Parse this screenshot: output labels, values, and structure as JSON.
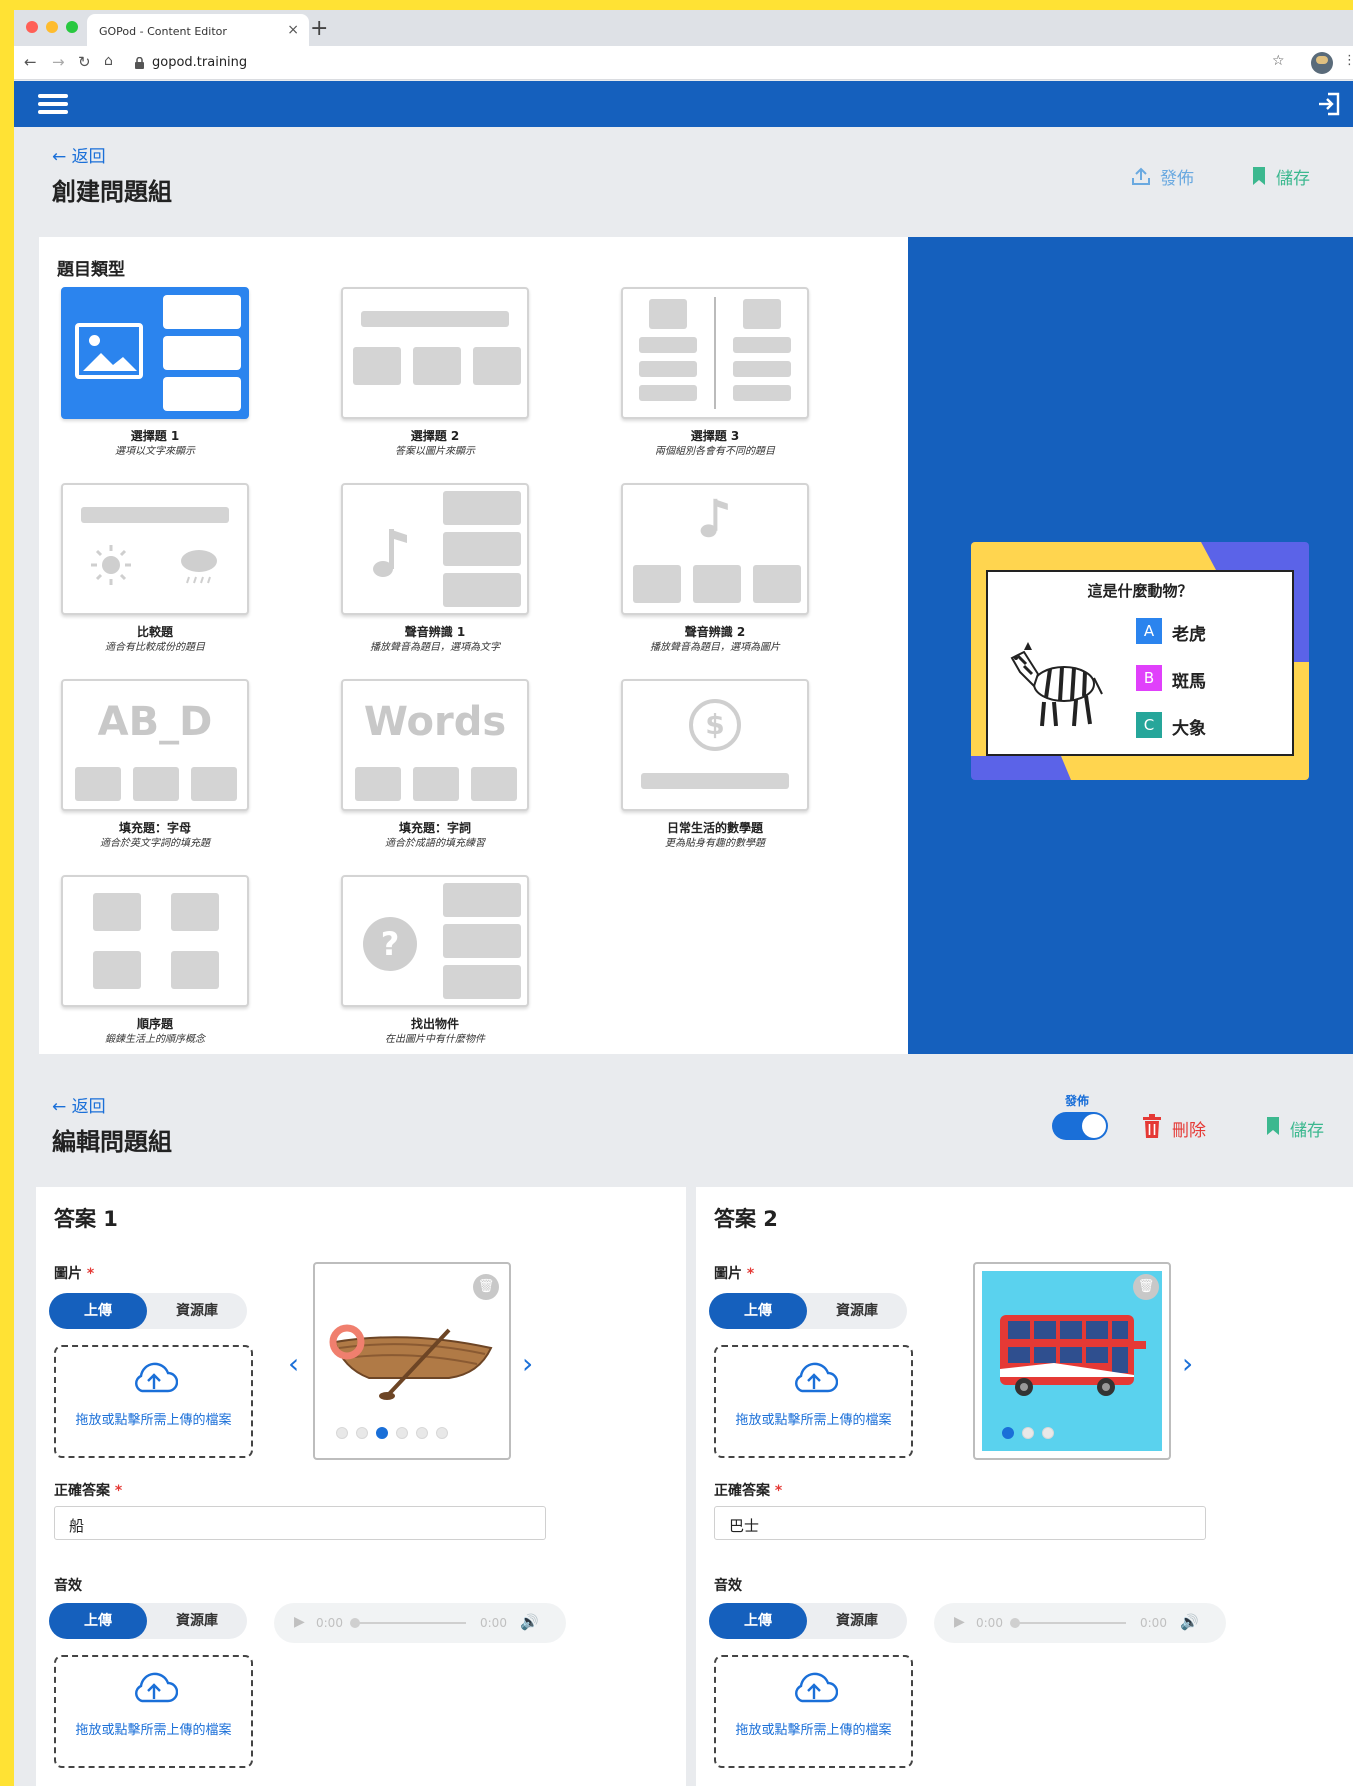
{
  "colors": {
    "brand": "#1560bd",
    "accent": "#1a6fd8",
    "save": "#3cb88f",
    "danger": "#e53935",
    "frame": "#ffe234"
  },
  "browser": {
    "tab_title": "GOPod - Content Editor",
    "tab_close": "×",
    "new_tab": "+",
    "url": "gopod.training"
  },
  "create": {
    "back_label": "← 返回",
    "title": "創建問題組",
    "publish_label": "發佈",
    "save_label": "儲存",
    "types_heading": "題目類型",
    "types": [
      {
        "name": "選擇題 1",
        "desc": "選項以文字來顯示"
      },
      {
        "name": "選擇題 2",
        "desc": "答案以圖片來顯示"
      },
      {
        "name": "選擇題 3",
        "desc": "兩個組別各會有不同的題目"
      },
      {
        "name": "比較題",
        "desc": "適合有比較成份的題目"
      },
      {
        "name": "聲音辨識 1",
        "desc": "播放聲音為題目，選項為文字"
      },
      {
        "name": "聲音辨識 2",
        "desc": "播放聲音為題目，選項為圖片"
      },
      {
        "name": "填充題：字母",
        "desc": "適合於英文字詞的填充題",
        "card_text": "AB_D"
      },
      {
        "name": "填充題：字詞",
        "desc": "適合於成語的填充練習",
        "card_text": "Words"
      },
      {
        "name": "日常生活的數學題",
        "desc": "更為貼身有趣的數學題",
        "card_text": "$"
      },
      {
        "name": "順序題",
        "desc": "鍛鍊生活上的順序概念"
      },
      {
        "name": "找出物件",
        "desc": "在出圖片中有什麼物件",
        "card_text": "?"
      }
    ],
    "preview": {
      "question": "這是什麼動物？",
      "options": [
        {
          "letter": "A",
          "text": "老虎",
          "color": "#2b84ee"
        },
        {
          "letter": "B",
          "text": "斑馬",
          "color": "#e040fb"
        },
        {
          "letter": "C",
          "text": "大象",
          "color": "#26a69a"
        }
      ]
    }
  },
  "edit": {
    "back_label": "← 返回",
    "title": "編輯問題組",
    "publish_toggle_label": "發佈",
    "publish_on": true,
    "delete_label": "刪除",
    "save_label": "儲存",
    "answers": [
      {
        "heading": "答案 1",
        "image_label": "圖片",
        "upload_label": "上傳",
        "library_label": "資源庫",
        "drop_text": "拖放或點擊所需上傳的檔案",
        "answer_label": "正確答案",
        "answer_value": "船",
        "sound_label": "音效",
        "audio_time_left": "0:00",
        "audio_time_right": "0:00",
        "carousel_total": 6,
        "carousel_active": 3
      },
      {
        "heading": "答案 2",
        "image_label": "圖片",
        "upload_label": "上傳",
        "library_label": "資源庫",
        "drop_text": "拖放或點擊所需上傳的檔案",
        "answer_label": "正確答案",
        "answer_value": "巴士",
        "sound_label": "音效",
        "audio_time_left": "0:00",
        "audio_time_right": "0:00",
        "carousel_total": 3,
        "carousel_active": 1
      }
    ]
  }
}
